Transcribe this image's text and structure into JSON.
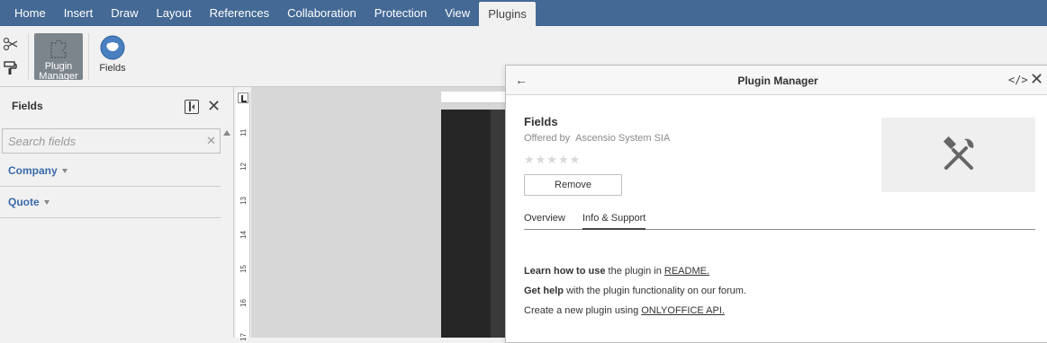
{
  "menubar": {
    "tabs": [
      "Home",
      "Insert",
      "Draw",
      "Layout",
      "References",
      "Collaboration",
      "Protection",
      "View",
      "Plugins"
    ],
    "active": "Plugins"
  },
  "toolbar": {
    "plugin_manager_label": "Plugin Manager",
    "fields_label": "Fields"
  },
  "fields_panel": {
    "title": "Fields",
    "search_placeholder": "Search fields",
    "groups": [
      "Company",
      "Quote"
    ]
  },
  "ruler": {
    "numbers": [
      "11",
      "12",
      "13",
      "14",
      "15",
      "16",
      "17"
    ]
  },
  "plugin_manager": {
    "title": "Plugin Manager",
    "plugin_name": "Fields",
    "offered_by_label": "Offered by",
    "vendor": "Ascensio System SIA",
    "rating_stars": 0,
    "remove_label": "Remove",
    "tabs": [
      "Overview",
      "Info & Support"
    ],
    "active_tab": "Info & Support",
    "info": {
      "line1_bold": "Learn how to use",
      "line1_text": " the plugin in ",
      "line1_link": "README.",
      "line2_bold": "Get help",
      "line2_text": " with the plugin functionality on our forum.",
      "line3_text": "Create a new plugin using ",
      "line3_link": "ONLYOFFICE API."
    }
  },
  "colors": {
    "menubar_bg": "#446995",
    "link_blue": "#3a6aa8",
    "pressed_btn": "#7d858c"
  }
}
